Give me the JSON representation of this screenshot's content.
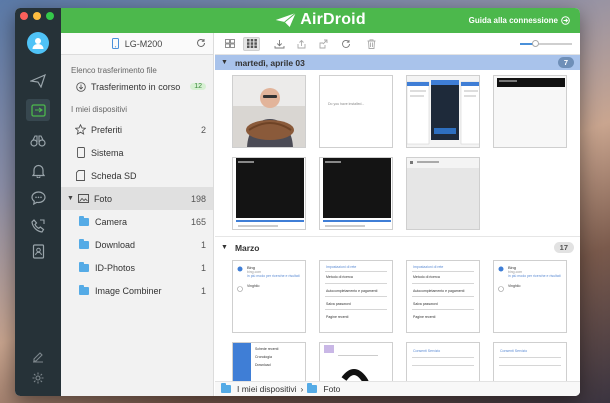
{
  "app": {
    "title": "AirDroid",
    "guide_label": "Guida alla connessione"
  },
  "device": {
    "name": "LG-M200"
  },
  "sidebar": {
    "transfer_section": "Elenco trasferimento file",
    "transfer_item": {
      "label": "Trasferimento in corso",
      "count": "12"
    },
    "devices_section": "I miei dispositivi",
    "items": [
      {
        "label": "Preferiti",
        "count": "2"
      },
      {
        "label": "Sistema",
        "count": ""
      },
      {
        "label": "Scheda SD",
        "count": ""
      },
      {
        "label": "Foto",
        "count": "198"
      }
    ],
    "folders": [
      {
        "label": "Camera",
        "count": "165"
      },
      {
        "label": "Download",
        "count": "1"
      },
      {
        "label": "ID-Photos",
        "count": "1"
      },
      {
        "label": "Image Combiner",
        "count": "1"
      }
    ]
  },
  "groups": [
    {
      "label": "martedì, aprile 03",
      "count": "7"
    },
    {
      "label": "Marzo",
      "count": "17"
    }
  ],
  "thumbs": {
    "t2_text": "Do you have installed...",
    "bing": "Bing",
    "bing_url": "bing.com",
    "bing_sub": "in più modo per ricerche e risultati",
    "vimplicito": "Vinghilo",
    "metodo": "Metodo di ricerca",
    "autocomp": "Autocompletamento e pagamenti",
    "salva": "Salva password",
    "pagine": "Pagine recenti",
    "impost": "Impostazioni di rete",
    "consenti": "Consenti Servizio",
    "scheda": "Schede recenti",
    "cronologia": "Cronologia",
    "download": "Download"
  },
  "breadcrumb": {
    "root": "I miei dispositivi",
    "sep": "›",
    "current": "Foto"
  },
  "colors": {
    "header_green": "#4cb84c",
    "rail": "#263238",
    "selected_group": "#a9c3eb",
    "folder_blue": "#55abe6"
  }
}
